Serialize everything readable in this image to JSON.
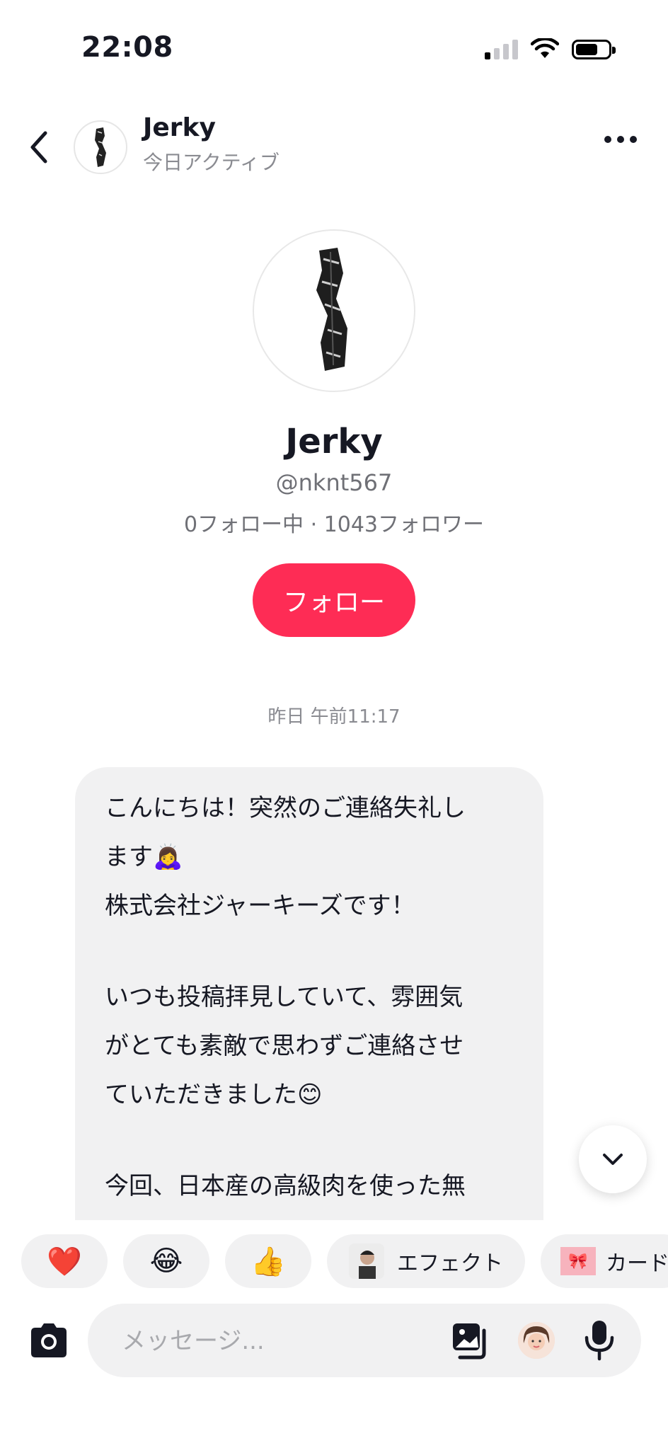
{
  "status_bar": {
    "time": "22:08"
  },
  "header": {
    "name": "Jerky",
    "status": "今日アクティブ"
  },
  "profile": {
    "name": "Jerky",
    "handle": "@nknt567",
    "stats": "0フォロー中 · 1043フォロワー",
    "follow_label": "フォロー"
  },
  "chat": {
    "timestamp": "昨日 午前11:17",
    "message": {
      "line1": "こんにちは！突然のご連絡失礼し",
      "line2": "ます🙇‍♀️",
      "line3": "株式会社ジャーキーズです！",
      "line4": "いつも投稿拝見していて、雰囲気",
      "line5": "がとても素敵で思わずご連絡させ",
      "line6": "ていただきました😊",
      "line7": "今回、日本産の高級肉を使った無"
    }
  },
  "reactions": {
    "heart": "❤️",
    "laugh": "😂",
    "thumbs": "👍",
    "effect_label": "エフェクト",
    "card_label": "カード"
  },
  "composer": {
    "placeholder": "メッセージ..."
  },
  "colors": {
    "accent": "#fe2c55",
    "bubble": "#f1f1f2",
    "muted_text": "#8a8b91"
  }
}
